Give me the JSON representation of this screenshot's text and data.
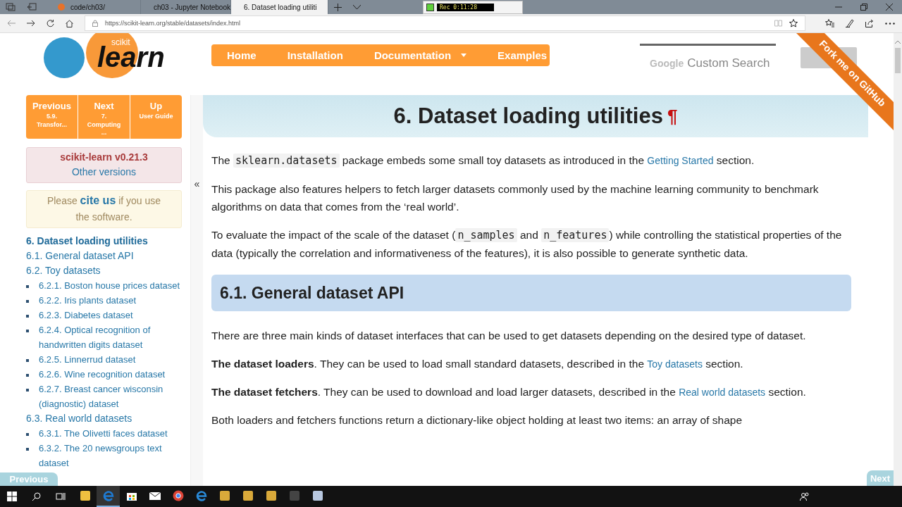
{
  "browser": {
    "tabs": [
      {
        "title": "code/ch03/",
        "selected": false
      },
      {
        "title": "ch03 - Jupyter Notebook",
        "selected": false
      },
      {
        "title": "6. Dataset loading utiliti",
        "selected": true
      }
    ],
    "recorder": {
      "time": "Rec 0:11:28"
    },
    "url": "https://scikit-learn.org/stable/datasets/index.html"
  },
  "header": {
    "logo": {
      "small": "scikit",
      "big": "learn"
    },
    "nav": [
      {
        "label": "Home",
        "dropdown": false
      },
      {
        "label": "Installation",
        "dropdown": false
      },
      {
        "label": "Documentation",
        "dropdown": true
      },
      {
        "label": "Examples",
        "dropdown": false
      }
    ],
    "search": {
      "brand": "Google",
      "placeholder": "Custom Search"
    },
    "ribbon": "Fork me on GitHub"
  },
  "sidebar": {
    "rel_buttons": [
      {
        "title": "Previous",
        "sub": "5.9. Transfor..."
      },
      {
        "title": "Next",
        "sub": "7. Computing ..."
      },
      {
        "title": "Up",
        "sub": "User Guide"
      }
    ],
    "version": "scikit-learn v0.21.3",
    "other_versions": "Other versions",
    "cite": [
      {
        "kind": "text",
        "text": "Please "
      },
      {
        "kind": "link",
        "text": "cite us"
      },
      {
        "kind": "text",
        "text": " if you use the software."
      }
    ],
    "collapse": "«",
    "toc": [
      {
        "label": "6. Dataset loading utilities",
        "selected": true
      },
      {
        "label": "6.1. General dataset API",
        "selected": false
      },
      {
        "label": "6.2. Toy datasets",
        "selected": false,
        "children": [
          {
            "label": "6.2.1. Boston house prices dataset",
            "selected": false
          },
          {
            "label": "6.2.2. Iris plants dataset",
            "selected": false
          },
          {
            "label": "6.2.3. Diabetes dataset",
            "selected": false
          },
          {
            "label": "6.2.4. Optical recognition of handwritten digits dataset",
            "selected": false
          },
          {
            "label": "6.2.5. Linnerrud dataset",
            "selected": false
          },
          {
            "label": "6.2.6. Wine recognition dataset",
            "selected": false
          },
          {
            "label": "6.2.7. Breast cancer wisconsin (diagnostic) dataset",
            "selected": false
          }
        ]
      },
      {
        "label": "6.3. Real world datasets",
        "selected": false,
        "children": [
          {
            "label": "6.3.1. The Olivetti faces dataset",
            "selected": false
          },
          {
            "label": "6.3.2. The 20 newsgroups text dataset",
            "selected": false
          }
        ]
      }
    ]
  },
  "content": {
    "title": "6. Dataset loading utilities",
    "pilcrow": "¶",
    "blocks": [
      {
        "kind": "p",
        "parts": [
          {
            "kind": "text",
            "text": "The "
          },
          {
            "kind": "code",
            "text": "sklearn.datasets"
          },
          {
            "kind": "text",
            "text": " package embeds some small toy datasets as introduced in the "
          },
          {
            "kind": "link",
            "text": "Getting Started"
          },
          {
            "kind": "text",
            "text": " section."
          }
        ]
      },
      {
        "kind": "p",
        "parts": [
          {
            "kind": "text",
            "text": "This package also features helpers to fetch larger datasets commonly used by the machine learning community to benchmark algorithms on data that comes from the ‘real world’."
          }
        ]
      },
      {
        "kind": "p",
        "parts": [
          {
            "kind": "text",
            "text": "To evaluate the impact of the scale of the dataset ("
          },
          {
            "kind": "code",
            "text": "n_samples"
          },
          {
            "kind": "text",
            "text": " and "
          },
          {
            "kind": "code",
            "text": "n_features"
          },
          {
            "kind": "text",
            "text": ") while controlling the statistical properties of the data (typically the correlation and informativeness of the features), it is also possible to generate synthetic data."
          }
        ]
      },
      {
        "kind": "h2",
        "parts": [
          {
            "kind": "text",
            "text": "6.1. General dataset API"
          }
        ]
      },
      {
        "kind": "p",
        "parts": [
          {
            "kind": "text",
            "text": "There are three main kinds of dataset interfaces that can be used to get datasets depending on the desired type of dataset."
          }
        ]
      },
      {
        "kind": "p",
        "parts": [
          {
            "kind": "bold",
            "text": "The dataset loaders"
          },
          {
            "kind": "text",
            "text": ". They can be used to load small standard datasets, described in the "
          },
          {
            "kind": "link",
            "text": "Toy datasets"
          },
          {
            "kind": "text",
            "text": " section."
          }
        ]
      },
      {
        "kind": "p",
        "parts": [
          {
            "kind": "bold",
            "text": "The dataset fetchers"
          },
          {
            "kind": "text",
            "text": ". They can be used to download and load larger datasets, described in the "
          },
          {
            "kind": "link",
            "text": "Real world datasets"
          },
          {
            "kind": "text",
            "text": " section."
          }
        ]
      },
      {
        "kind": "p",
        "parts": [
          {
            "kind": "text",
            "text": "Both loaders and fetchers functions return a dictionary-like object holding at least two items: an array of shape"
          }
        ]
      }
    ]
  },
  "floating": {
    "previous": "Previous",
    "next": "Next"
  },
  "taskbar": {
    "apps": [
      {
        "kind": "folder",
        "active": false
      },
      {
        "kind": "edge",
        "active": true
      },
      {
        "kind": "store",
        "active": false
      },
      {
        "kind": "mail",
        "active": false
      },
      {
        "kind": "chrome",
        "active": false
      },
      {
        "kind": "ie",
        "active": false
      },
      {
        "kind": "app",
        "active": false
      },
      {
        "kind": "app",
        "active": false
      },
      {
        "kind": "app",
        "active": false
      },
      {
        "kind": "terminal",
        "active": false
      },
      {
        "kind": "paint",
        "active": false
      }
    ]
  }
}
